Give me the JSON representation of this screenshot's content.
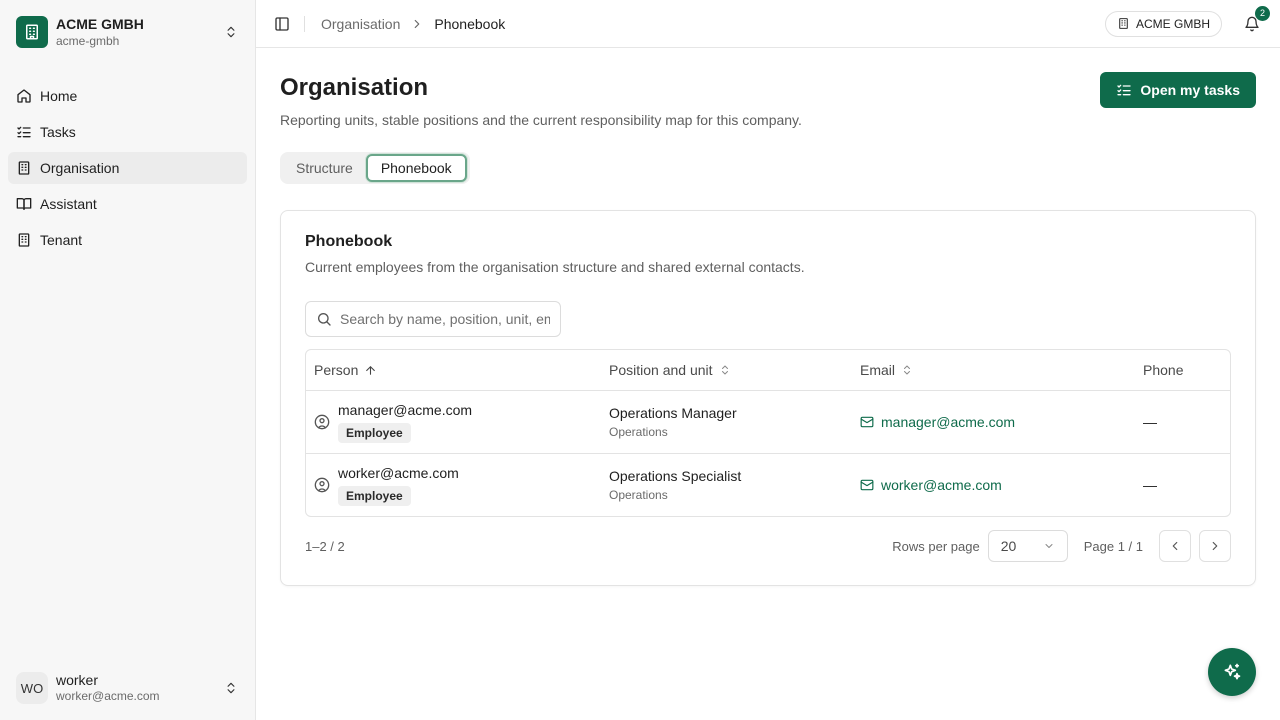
{
  "org": {
    "name": "ACME GMBH",
    "slug": "acme-gmbh"
  },
  "nav": [
    {
      "label": "Home",
      "icon": "home-icon",
      "active": false
    },
    {
      "label": "Tasks",
      "icon": "list-checks-icon",
      "active": false
    },
    {
      "label": "Organisation",
      "icon": "building-icon",
      "active": true
    },
    {
      "label": "Assistant",
      "icon": "book-open-icon",
      "active": false
    },
    {
      "label": "Tenant",
      "icon": "building-icon",
      "active": false
    }
  ],
  "user": {
    "initials": "WO",
    "name": "worker",
    "email": "worker@acme.com"
  },
  "breadcrumb": {
    "parent": "Organisation",
    "current": "Phonebook"
  },
  "topbar": {
    "tenant_label": "ACME GMBH",
    "notification_count": "2"
  },
  "page": {
    "title": "Organisation",
    "subtitle": "Reporting units, stable positions and the current responsibility map for this company.",
    "primary_button": "Open my tasks"
  },
  "tabs": [
    {
      "label": "Structure",
      "active": false
    },
    {
      "label": "Phonebook",
      "active": true
    }
  ],
  "phonebook": {
    "title": "Phonebook",
    "subtitle": "Current employees from the organisation structure and shared external contacts.",
    "search_placeholder": "Search by name, position, unit, email or phone",
    "columns": {
      "person": "Person",
      "position": "Position and unit",
      "email": "Email",
      "phone": "Phone"
    },
    "rows": [
      {
        "email": "manager@acme.com",
        "badge": "Employee",
        "position": "Operations Manager",
        "unit": "Operations",
        "phone": "—"
      },
      {
        "email": "worker@acme.com",
        "badge": "Employee",
        "position": "Operations Specialist",
        "unit": "Operations",
        "phone": "—"
      }
    ],
    "footer": {
      "range": "1–2 / 2",
      "rows_per_page_label": "Rows per page",
      "rows_per_page_value": "20",
      "page_info": "Page 1 / 1"
    }
  },
  "colors": {
    "brand": "#0f6b4b",
    "sidebar_bg": "#f7f7f7",
    "active_nav_bg": "#ececec",
    "tab_focus_ring": "#6aa68a"
  }
}
